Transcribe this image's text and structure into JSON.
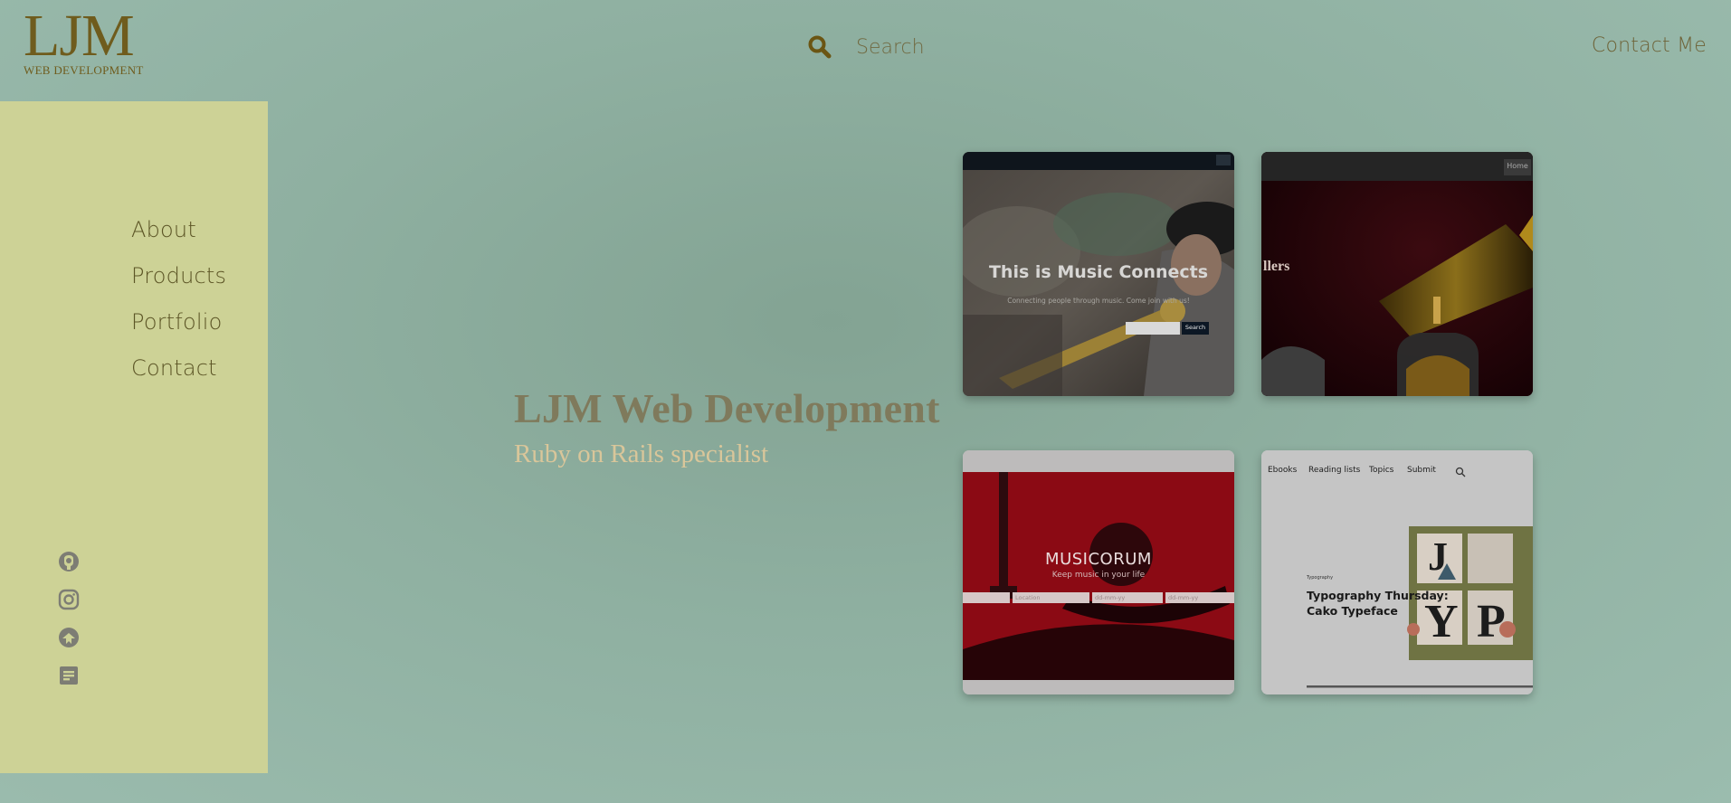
{
  "brand": {
    "logo_text": "LJM",
    "logo_subtitle": "WEB DEVELOPMENT"
  },
  "header": {
    "search_placeholder": "Search",
    "contact_label": "Contact Me"
  },
  "sidebar": {
    "nav": [
      {
        "label": "About"
      },
      {
        "label": "Products"
      },
      {
        "label": "Portfolio"
      },
      {
        "label": "Contact"
      }
    ],
    "social_icons": [
      "github-icon",
      "instagram-icon",
      "gitlab-icon",
      "blog-icon"
    ]
  },
  "hero": {
    "title": "LJM Web Development",
    "subtitle": "Ruby on Rails specialist"
  },
  "portfolio": [
    {
      "title": "This is Music Connects",
      "tagline": "Connecting people through music. Come join with us!",
      "button": "Search"
    },
    {
      "title": "llers",
      "nav_button": "Home"
    },
    {
      "title": "MUSICORUM",
      "tagline": "Keep music in your life",
      "field_location": "Location",
      "field_date": "dd-mm-yy"
    },
    {
      "nav": [
        "Ebooks",
        "Reading lists",
        "Topics",
        "Submit"
      ],
      "kicker": "Typography",
      "title_line1": "Typography Thursday:",
      "title_line2": "Cako Typeface",
      "art_letters": [
        "J",
        "Y",
        "P"
      ]
    }
  ],
  "colors": {
    "background": "#8fb0a1",
    "sidebar": "#cdd296",
    "logo": "#6f5c1d",
    "hero_title": "#7f7a5c",
    "hero_subtitle": "#d9c69a",
    "musicorum_red": "#8b0a14"
  }
}
